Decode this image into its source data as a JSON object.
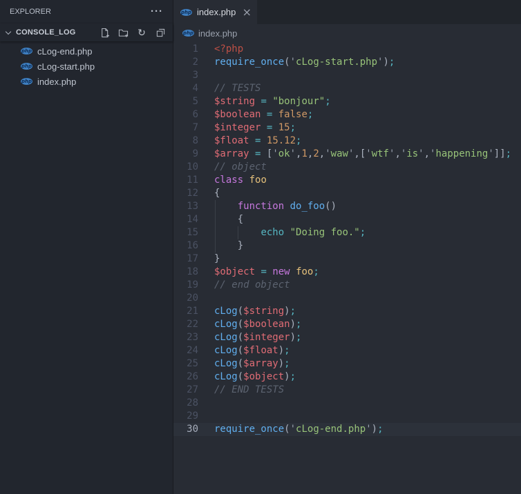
{
  "colors": {
    "editor_bg": "#282c34",
    "sidebar_bg": "#22262e",
    "tabbar_bg": "#21252b",
    "current_line_bg": "#2c313a",
    "php_icon_blue": "#3e7fc1",
    "syntax": {
      "php_tag": "#be5046",
      "variable": "#e06c75",
      "function": "#61afef",
      "keyword": "#c678dd",
      "operator": "#56b6c2",
      "string": "#98c379",
      "number_const": "#d19a66",
      "class_name": "#e5c07b",
      "comment": "#5c6370",
      "punctuation": "#abb2bf"
    }
  },
  "icons": {
    "more": "···",
    "refresh": "↻",
    "close": "×"
  },
  "sidebar": {
    "title": "EXPLORER",
    "section": {
      "name": "CONSOLE_LOG"
    },
    "files": [
      {
        "name": "cLog-end.php",
        "icon": "php"
      },
      {
        "name": "cLog-start.php",
        "icon": "php"
      },
      {
        "name": "index.php",
        "icon": "php"
      }
    ],
    "php_icon_text": "php"
  },
  "tabbar": {
    "tabs": [
      {
        "label": "index.php",
        "active": true,
        "icon": "php"
      }
    ]
  },
  "breadcrumb": {
    "items": [
      {
        "label": "index.php",
        "icon": "php"
      }
    ]
  },
  "editor": {
    "language": "php",
    "current_line": 30,
    "lines": [
      {
        "n": 1,
        "t": [
          [
            "tag",
            "<?php"
          ]
        ]
      },
      {
        "n": 2,
        "t": [
          [
            "blue",
            "require_once"
          ],
          [
            "pln",
            "("
          ],
          [
            "gry",
            "'"
          ],
          [
            "grn",
            "cLog-start.php"
          ],
          [
            "gry",
            "'"
          ],
          [
            "pln",
            ")"
          ],
          [
            "cyan",
            ";"
          ]
        ]
      },
      {
        "n": 3,
        "t": []
      },
      {
        "n": 4,
        "t": [
          [
            "com",
            "// TESTS"
          ]
        ]
      },
      {
        "n": 5,
        "t": [
          [
            "red",
            "$string"
          ],
          [
            "pln",
            " "
          ],
          [
            "cyan",
            "="
          ],
          [
            "pln",
            " "
          ],
          [
            "grn",
            "\"bonjour\""
          ],
          [
            "cyan",
            ";"
          ]
        ]
      },
      {
        "n": 6,
        "t": [
          [
            "red",
            "$boolean"
          ],
          [
            "pln",
            " "
          ],
          [
            "cyan",
            "="
          ],
          [
            "pln",
            " "
          ],
          [
            "org",
            "false"
          ],
          [
            "cyan",
            ";"
          ]
        ]
      },
      {
        "n": 7,
        "t": [
          [
            "red",
            "$integer"
          ],
          [
            "pln",
            " "
          ],
          [
            "cyan",
            "="
          ],
          [
            "pln",
            " "
          ],
          [
            "org",
            "15"
          ],
          [
            "cyan",
            ";"
          ]
        ]
      },
      {
        "n": 8,
        "t": [
          [
            "red",
            "$float"
          ],
          [
            "pln",
            " "
          ],
          [
            "cyan",
            "="
          ],
          [
            "pln",
            " "
          ],
          [
            "org",
            "15.12"
          ],
          [
            "cyan",
            ";"
          ]
        ]
      },
      {
        "n": 9,
        "t": [
          [
            "red",
            "$array"
          ],
          [
            "pln",
            " "
          ],
          [
            "cyan",
            "="
          ],
          [
            "pln",
            " ["
          ],
          [
            "gry",
            "'"
          ],
          [
            "grn",
            "ok"
          ],
          [
            "gry",
            "'"
          ],
          [
            "pln",
            ","
          ],
          [
            "org",
            "1"
          ],
          [
            "pln",
            ","
          ],
          [
            "org",
            "2"
          ],
          [
            "pln",
            ","
          ],
          [
            "gry",
            "'"
          ],
          [
            "grn",
            "waw"
          ],
          [
            "gry",
            "'"
          ],
          [
            "pln",
            ",["
          ],
          [
            "gry",
            "'"
          ],
          [
            "grn",
            "wtf"
          ],
          [
            "gry",
            "'"
          ],
          [
            "pln",
            ","
          ],
          [
            "gry",
            "'"
          ],
          [
            "grn",
            "is"
          ],
          [
            "gry",
            "'"
          ],
          [
            "pln",
            ","
          ],
          [
            "gry",
            "'"
          ],
          [
            "grn",
            "happening"
          ],
          [
            "gry",
            "'"
          ],
          [
            "pln",
            "]]"
          ],
          [
            "cyan",
            ";"
          ]
        ]
      },
      {
        "n": 10,
        "t": [
          [
            "com",
            "// object"
          ]
        ]
      },
      {
        "n": 11,
        "t": [
          [
            "mag",
            "class"
          ],
          [
            "pln",
            " "
          ],
          [
            "gold",
            "foo"
          ]
        ]
      },
      {
        "n": 12,
        "t": [
          [
            "pln",
            "{"
          ]
        ]
      },
      {
        "n": 13,
        "g": [
          0
        ],
        "t": [
          [
            "pln",
            "    "
          ],
          [
            "mag",
            "function"
          ],
          [
            "pln",
            " "
          ],
          [
            "blue",
            "do_foo"
          ],
          [
            "pln",
            "()"
          ]
        ]
      },
      {
        "n": 14,
        "g": [
          0
        ],
        "t": [
          [
            "pln",
            "    {"
          ]
        ]
      },
      {
        "n": 15,
        "g": [
          0,
          4
        ],
        "t": [
          [
            "pln",
            "        "
          ],
          [
            "cyan",
            "echo"
          ],
          [
            "pln",
            " "
          ],
          [
            "grn",
            "\"Doing foo.\""
          ],
          [
            "cyan",
            ";"
          ]
        ]
      },
      {
        "n": 16,
        "g": [
          0
        ],
        "t": [
          [
            "pln",
            "    }"
          ]
        ]
      },
      {
        "n": 17,
        "t": [
          [
            "pln",
            "}"
          ]
        ]
      },
      {
        "n": 18,
        "t": [
          [
            "red",
            "$object"
          ],
          [
            "pln",
            " "
          ],
          [
            "cyan",
            "="
          ],
          [
            "pln",
            " "
          ],
          [
            "mag",
            "new"
          ],
          [
            "pln",
            " "
          ],
          [
            "gold",
            "foo"
          ],
          [
            "cyan",
            ";"
          ]
        ]
      },
      {
        "n": 19,
        "t": [
          [
            "com",
            "// end object"
          ]
        ]
      },
      {
        "n": 20,
        "t": []
      },
      {
        "n": 21,
        "t": [
          [
            "blue",
            "cLog"
          ],
          [
            "pln",
            "("
          ],
          [
            "red",
            "$string"
          ],
          [
            "pln",
            ")"
          ],
          [
            "cyan",
            ";"
          ]
        ]
      },
      {
        "n": 22,
        "t": [
          [
            "blue",
            "cLog"
          ],
          [
            "pln",
            "("
          ],
          [
            "red",
            "$boolean"
          ],
          [
            "pln",
            ")"
          ],
          [
            "cyan",
            ";"
          ]
        ]
      },
      {
        "n": 23,
        "t": [
          [
            "blue",
            "cLog"
          ],
          [
            "pln",
            "("
          ],
          [
            "red",
            "$integer"
          ],
          [
            "pln",
            ")"
          ],
          [
            "cyan",
            ";"
          ]
        ]
      },
      {
        "n": 24,
        "t": [
          [
            "blue",
            "cLog"
          ],
          [
            "pln",
            "("
          ],
          [
            "red",
            "$float"
          ],
          [
            "pln",
            ")"
          ],
          [
            "cyan",
            ";"
          ]
        ]
      },
      {
        "n": 25,
        "t": [
          [
            "blue",
            "cLog"
          ],
          [
            "pln",
            "("
          ],
          [
            "red",
            "$array"
          ],
          [
            "pln",
            ")"
          ],
          [
            "cyan",
            ";"
          ]
        ]
      },
      {
        "n": 26,
        "t": [
          [
            "blue",
            "cLog"
          ],
          [
            "pln",
            "("
          ],
          [
            "red",
            "$object"
          ],
          [
            "pln",
            ")"
          ],
          [
            "cyan",
            ";"
          ]
        ]
      },
      {
        "n": 27,
        "t": [
          [
            "com",
            "// END TESTS"
          ]
        ]
      },
      {
        "n": 28,
        "t": []
      },
      {
        "n": 29,
        "t": []
      },
      {
        "n": 30,
        "t": [
          [
            "blue",
            "require_once"
          ],
          [
            "pln",
            "("
          ],
          [
            "gry",
            "'"
          ],
          [
            "grn",
            "cLog-end.php"
          ],
          [
            "gry",
            "'"
          ],
          [
            "pln",
            ")"
          ],
          [
            "cyan",
            ";"
          ]
        ]
      }
    ]
  }
}
